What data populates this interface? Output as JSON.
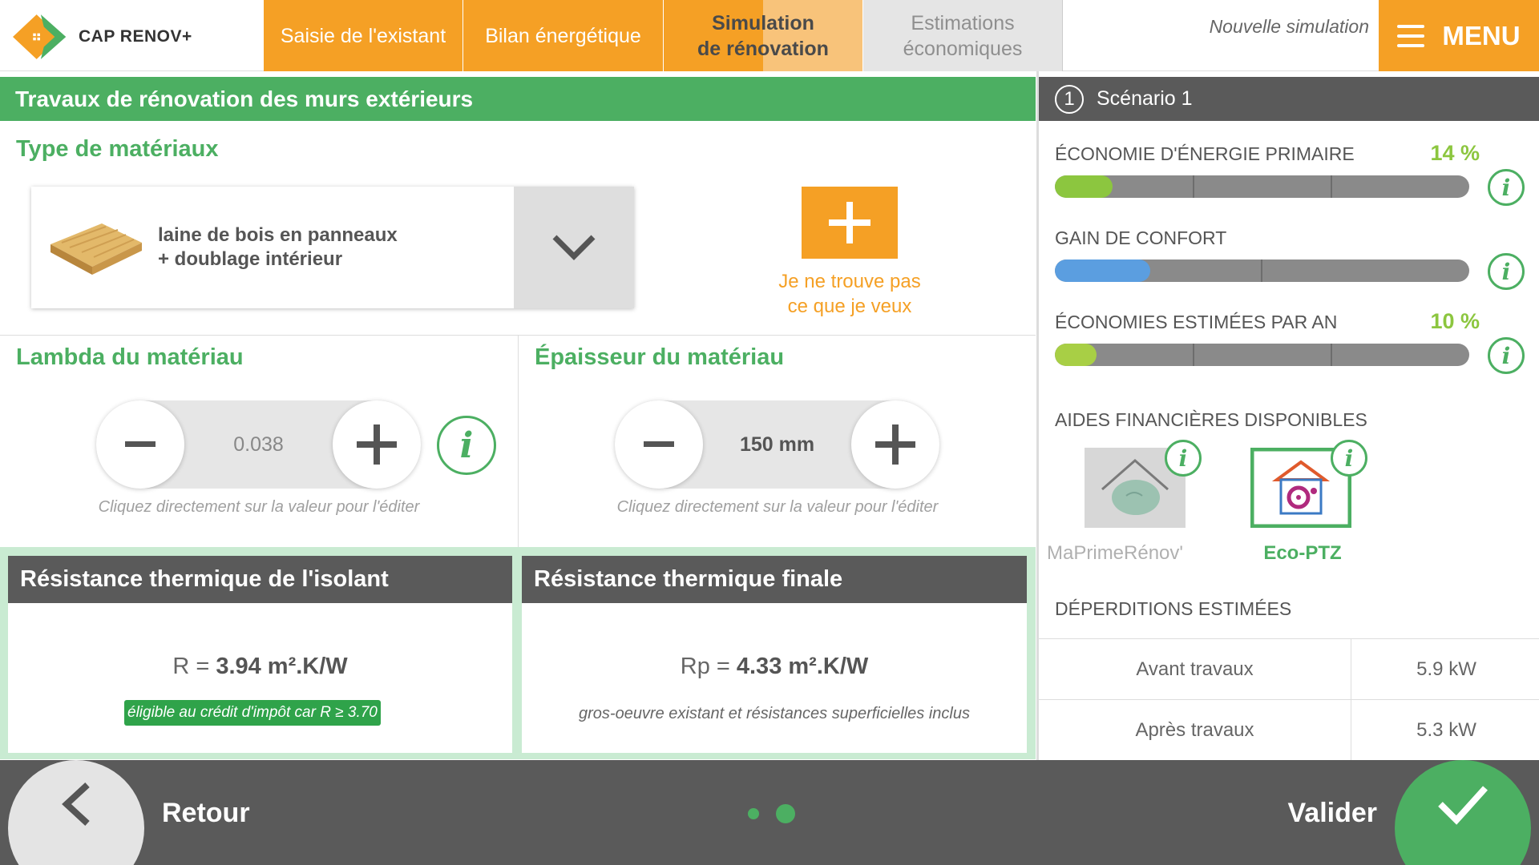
{
  "header": {
    "brand": "CAP RENOV+",
    "tabs": [
      {
        "label": "Saisie de l'existant"
      },
      {
        "label": "Bilan énergétique"
      },
      {
        "line1": "Simulation",
        "line2": "de rénovation"
      },
      {
        "line1": "Estimations",
        "line2": "économiques"
      }
    ],
    "new_simulation": "Nouvelle simulation",
    "menu_label": "MENU"
  },
  "section": {
    "title": "Travaux de rénovation des murs extérieurs",
    "material_type_title": "Type de matériaux",
    "material_line1": "laine de bois en panneaux",
    "material_line2": "+ doublage intérieur",
    "not_found_line1": "Je ne trouve pas",
    "not_found_line2": "ce que je veux"
  },
  "lambda": {
    "title": "Lambda du matériau",
    "value": "0.038",
    "hint": "Cliquez directement sur la valeur pour l'éditer"
  },
  "thickness": {
    "title": "Épaisseur du matériau",
    "value": "150 mm",
    "hint": "Cliquez directement sur la valeur pour l'éditer"
  },
  "resistance_isolant": {
    "title": "Résistance thermique de l'isolant",
    "prefix": "R = ",
    "value": "3.94 m².K/W",
    "badge": "éligible au crédit d'impôt car R ≥ 3.70"
  },
  "resistance_finale": {
    "title": "Résistance thermique finale",
    "prefix": "Rp = ",
    "value": "4.33 m².K/W",
    "note": "gros-oeuvre existant et résistances superficielles inclus"
  },
  "scenario": {
    "number": "1",
    "label": "Scénario 1"
  },
  "metrics": [
    {
      "label": "ÉCONOMIE D'ÉNERGIE PRIMAIRE",
      "pct": "14 %",
      "fill_fraction": 0.14,
      "color": "#8cc63f"
    },
    {
      "label": "GAIN DE CONFORT",
      "pct": "",
      "fill_fraction": 0.23,
      "color": "#5b9ee0"
    },
    {
      "label": "ÉCONOMIES ESTIMÉES PAR AN",
      "pct": "10 %",
      "fill_fraction": 0.1,
      "color": "#a8cf45"
    }
  ],
  "aids": {
    "title": "AIDES FINANCIÈRES DISPONIBLES",
    "items": [
      {
        "label": "MaPrimeRénov'",
        "color": "#b5b5b5"
      },
      {
        "label": "Eco-PTZ",
        "color": "#4caf62"
      }
    ]
  },
  "deperditions": {
    "title": "DÉPERDITIONS ESTIMÉES",
    "rows": [
      {
        "label": "Avant travaux",
        "value": "5.9 kW"
      },
      {
        "label": "Après travaux",
        "value": "5.3 kW"
      }
    ]
  },
  "footer": {
    "back_label": "Retour",
    "validate_label": "Valider"
  },
  "colors": {
    "brand_orange": "#f5a025",
    "brand_green": "#4caf62",
    "dark_gray": "#5a5a5a"
  }
}
